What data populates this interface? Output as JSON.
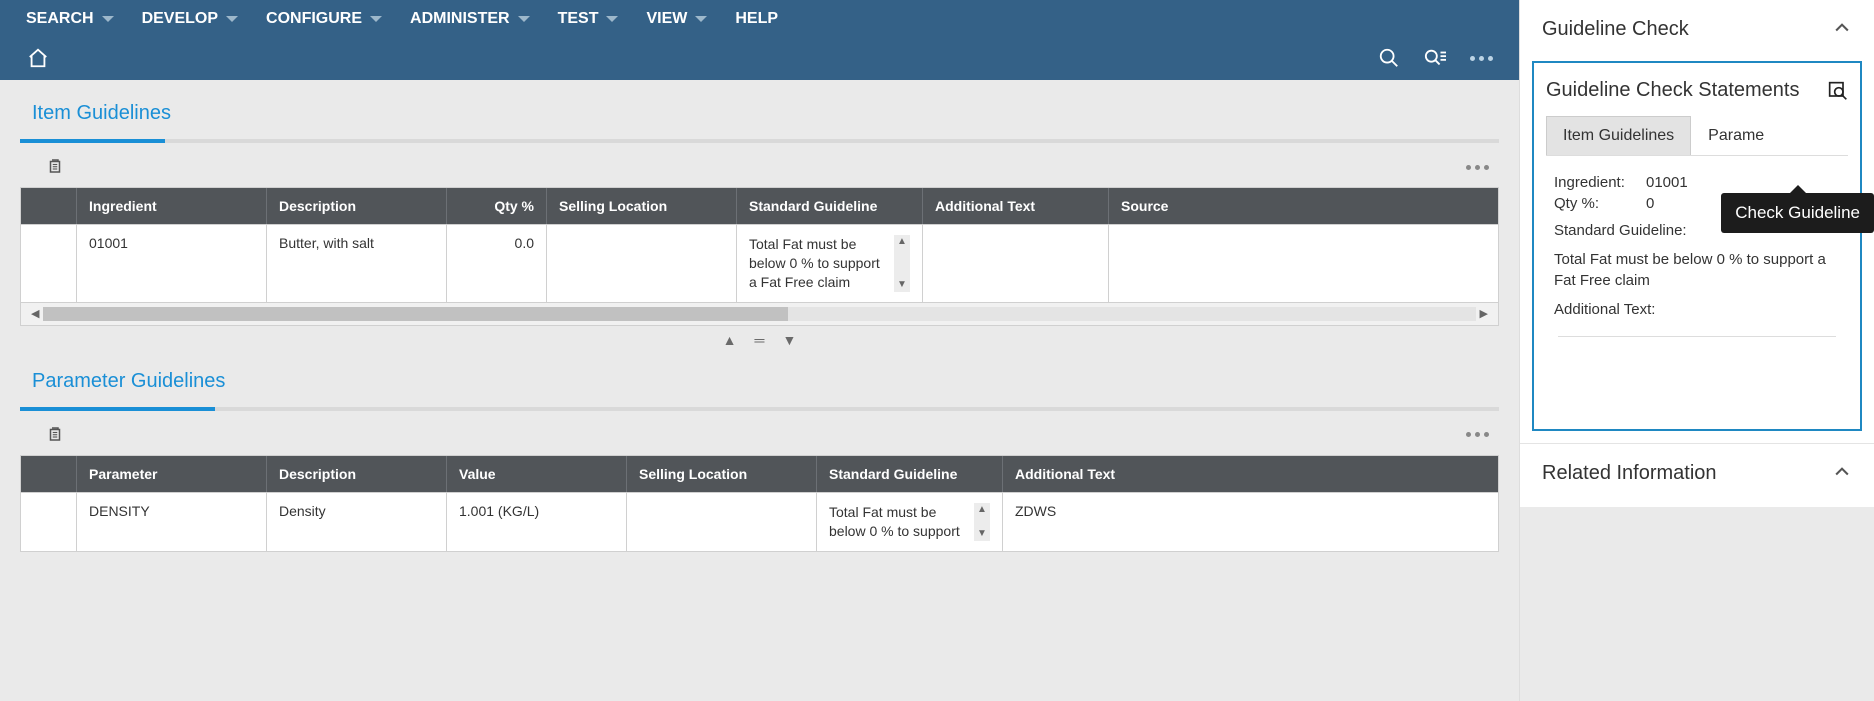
{
  "menu": {
    "items": [
      "SEARCH",
      "DEVELOP",
      "CONFIGURE",
      "ADMINISTER",
      "TEST",
      "VIEW",
      "HELP"
    ],
    "has_dropdown": [
      true,
      true,
      true,
      true,
      true,
      true,
      false
    ]
  },
  "sections": {
    "item_guidelines_title": "Item Guidelines",
    "param_guidelines_title": "Parameter Guidelines"
  },
  "item_table": {
    "headers": [
      "",
      "Ingredient",
      "Description",
      "Qty %",
      "Selling Location",
      "Standard Guideline",
      "Additional Text",
      "Source"
    ],
    "rows": [
      {
        "ingredient": "01001",
        "description": "Butter, with salt",
        "qty": "0.0",
        "selling_location": "",
        "guideline": "Total Fat must be below 0 % to support a Fat Free claim",
        "additional_text": "",
        "source": ""
      }
    ]
  },
  "param_table": {
    "headers": [
      "",
      "Parameter",
      "Description",
      "Value",
      "Selling Location",
      "Standard Guideline",
      "Additional Text"
    ],
    "rows": [
      {
        "parameter": "DENSITY",
        "description": "Density",
        "value": "1.001 (KG/L)",
        "selling_location": "",
        "guideline": "Total Fat must be below 0 % to support",
        "additional_text": "ZDWS"
      }
    ]
  },
  "side": {
    "title": "Guideline Check",
    "card_title": "Guideline Check Statements",
    "tabs": [
      "Item Guidelines",
      "Parame"
    ],
    "tooltip": "Check Guideline",
    "details": {
      "ingredient_label": "Ingredient:",
      "ingredient_value": "01001",
      "qty_label": "Qty %:",
      "qty_value": "0",
      "std_label": "Standard Guideline:",
      "std_text": "Total Fat must be below 0 % to support a Fat Free claim",
      "addl_label": "Additional Text:"
    },
    "related_title": "Related Information"
  }
}
